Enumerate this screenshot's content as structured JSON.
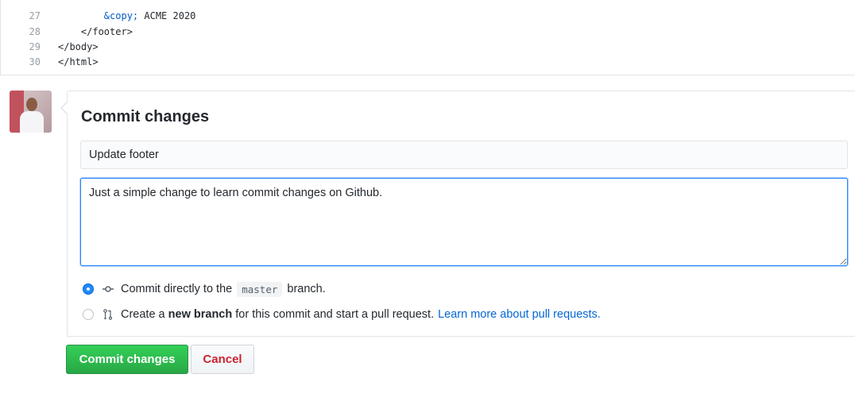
{
  "code": {
    "lines": [
      {
        "number": "27",
        "indent": "        ",
        "entity": "&copy;",
        "text": " ACME 2020"
      },
      {
        "number": "28",
        "indent": "    ",
        "entity": "",
        "text": "</footer>"
      },
      {
        "number": "29",
        "indent": "",
        "entity": "",
        "text": "</body>"
      },
      {
        "number": "30",
        "indent": "",
        "entity": "",
        "text": "</html>"
      }
    ]
  },
  "commit": {
    "title": "Commit changes",
    "summary_value": "Update footer",
    "description_value": "Just a simple change to learn commit changes on Github.",
    "options": {
      "direct": {
        "prefix": "Commit directly to the",
        "branch": "master",
        "suffix": "branch.",
        "selected": true
      },
      "new_branch": {
        "prefix": "Create a",
        "bold": "new branch",
        "suffix": "for this commit and start a pull request.",
        "link": "Learn more about pull requests.",
        "selected": false
      }
    },
    "buttons": {
      "commit": "Commit changes",
      "cancel": "Cancel"
    }
  },
  "icons": {
    "avatar": "user-avatar",
    "commit": "git-commit-icon",
    "pull_request": "git-pull-request-icon"
  },
  "colors": {
    "accent": "#0366d6",
    "commit_button": "#28a745",
    "cancel_text": "#cb2431"
  }
}
